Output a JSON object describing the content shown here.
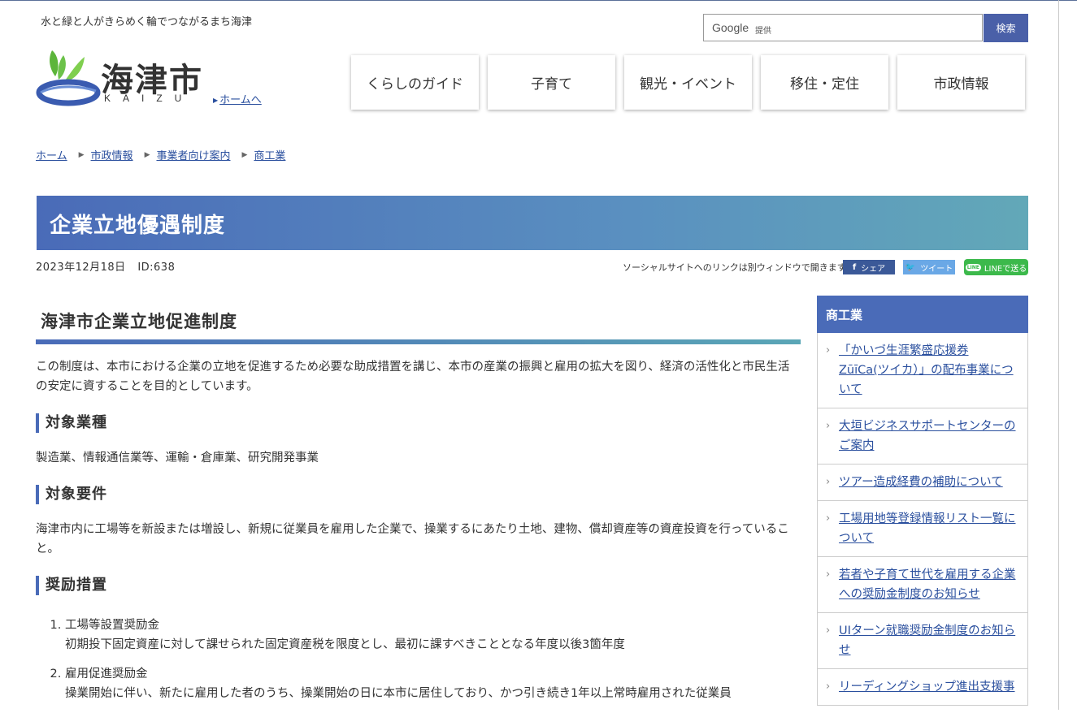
{
  "header": {
    "tagline": "水と緑と人がきらめく輪でつながるまち海津",
    "logo_text": "海津市",
    "logo_sub": "KAIZU",
    "home_link": "ホームへ"
  },
  "search": {
    "provider_logo": "Google",
    "provider_suffix": "提供",
    "button_label": "検索"
  },
  "nav": [
    {
      "label": "くらしのガイド"
    },
    {
      "label": "子育て"
    },
    {
      "label": "観光・イベント"
    },
    {
      "label": "移住・定住"
    },
    {
      "label": "市政情報"
    }
  ],
  "breadcrumb": [
    {
      "label": "ホーム"
    },
    {
      "label": "市政情報"
    },
    {
      "label": "事業者向け案内"
    },
    {
      "label": "商工業"
    }
  ],
  "page": {
    "title": "企業立地優遇制度",
    "date": "2023年12月18日",
    "id": "ID:638"
  },
  "social": {
    "note": "ソーシャルサイトへのリンクは別ウィンドウで開きます",
    "facebook": "シェア",
    "twitter": "ツイート",
    "line": "LINEで送る",
    "facebook_icon": "f",
    "twitter_icon": "🐦",
    "line_icon": "LINE"
  },
  "content": {
    "heading": "海津市企業立地促進制度",
    "intro": "この制度は、本市における企業の立地を促進するため必要な助成措置を講じ、本市の産業の振興と雇用の拡大を図り、経済の活性化と市民生活の安定に資することを目的としています。",
    "section1_title": "対象業種",
    "section1_body": "製造業、情報通信業等、運輸・倉庫業、研究開発事業",
    "section2_title": "対象要件",
    "section2_body": "海津市内に工場等を新設または増設し、新規に従業員を雇用した企業で、操業するにあたり土地、建物、償却資産等の資産投資を行っていること。",
    "section3_title": "奨励措置",
    "list": [
      {
        "title": "工場等設置奨励金",
        "desc": "初期投下固定資産に対して課せられた固定資産税を限度とし、最初に課すべきこととなる年度以後3箇年度"
      },
      {
        "title": "雇用促進奨励金",
        "desc": "操業開始に伴い、新たに雇用した者のうち、操業開始の日に本市に居住しており、かつ引き続き1年以上常時雇用された従業員"
      }
    ]
  },
  "sidebar": {
    "title": "商工業",
    "items": [
      {
        "label": "「かいづ生涯繁盛応援券ZūīCa(ツイカ）」の配布事業について"
      },
      {
        "label": "大垣ビジネスサポートセンターのご案内"
      },
      {
        "label": "ツアー造成経費の補助について"
      },
      {
        "label": "工場用地等登録情報リスト一覧について"
      },
      {
        "label": "若者や子育て世代を雇用する企業への奨励金制度のお知らせ"
      },
      {
        "label": "UIターン就職奨励金制度のお知らせ"
      },
      {
        "label": "リーディングショップ進出支援事"
      }
    ]
  },
  "colors": {
    "accent": "#4a6bb8",
    "link": "#2a4f9e",
    "facebook": "#3b5998",
    "twitter": "#6aa8e6",
    "line": "#3cb94b"
  }
}
